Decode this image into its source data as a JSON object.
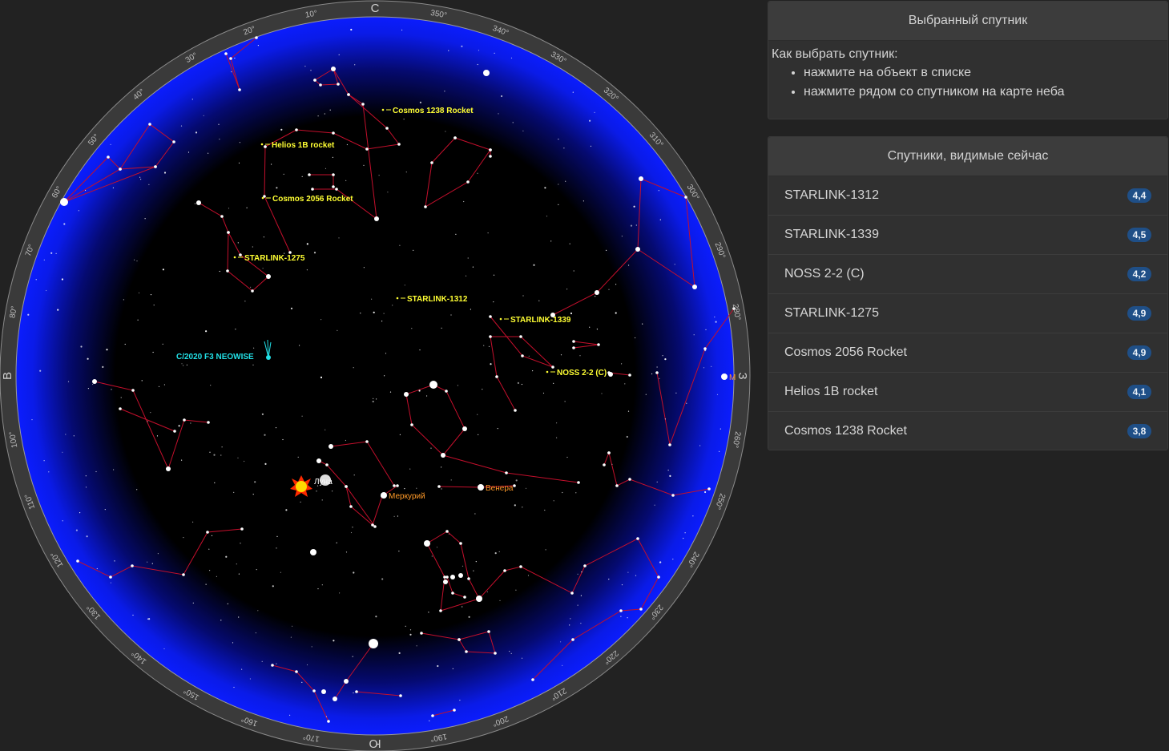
{
  "sky_map": {
    "compass": {
      "north": "С",
      "south": "Ю",
      "east": "В",
      "west": "З"
    },
    "azimuth_step_deg": 10,
    "colors": {
      "sky": "#000000",
      "horizon_glow": "#0a18ff",
      "rim": "#3a3a3a",
      "constellation_lines": "#c40f2c",
      "satellite_labels": "#ffff33",
      "comet": "#22e0e6",
      "planets": "#ff9a28"
    },
    "satellites": [
      {
        "name": "Cosmos 1238 Rocket"
      },
      {
        "name": "Helios 1B rocket"
      },
      {
        "name": "Cosmos 2056 Rocket"
      },
      {
        "name": "STARLINK-1275"
      },
      {
        "name": "STARLINK-1312"
      },
      {
        "name": "STARLINK-1339"
      },
      {
        "name": "NOSS 2-2 (C)"
      }
    ],
    "comet": {
      "name": "C/2020 F3 NEOWISE"
    },
    "bodies": {
      "sun_icon": "sun-icon",
      "moon": "Луна",
      "mercury": "Меркурий",
      "venus": "Венера",
      "mars_abbr": "М"
    }
  },
  "selected_panel": {
    "title": "Выбранный спутник",
    "help_title": "Как выбрать спутник:",
    "help_items": [
      "нажмите на объект в списке",
      "нажмите рядом со спутником на карте неба"
    ]
  },
  "visible_panel": {
    "title": "Спутники, видимые сейчас",
    "items": [
      {
        "name": "STARLINK-1312",
        "magnitude": "4,4"
      },
      {
        "name": "STARLINK-1339",
        "magnitude": "4,5"
      },
      {
        "name": "NOSS 2-2 (C)",
        "magnitude": "4,2"
      },
      {
        "name": "STARLINK-1275",
        "magnitude": "4,9"
      },
      {
        "name": "Cosmos 2056 Rocket",
        "magnitude": "4,9"
      },
      {
        "name": "Helios 1B rocket",
        "magnitude": "4,1"
      },
      {
        "name": "Cosmos 1238 Rocket",
        "magnitude": "3,8"
      }
    ]
  }
}
